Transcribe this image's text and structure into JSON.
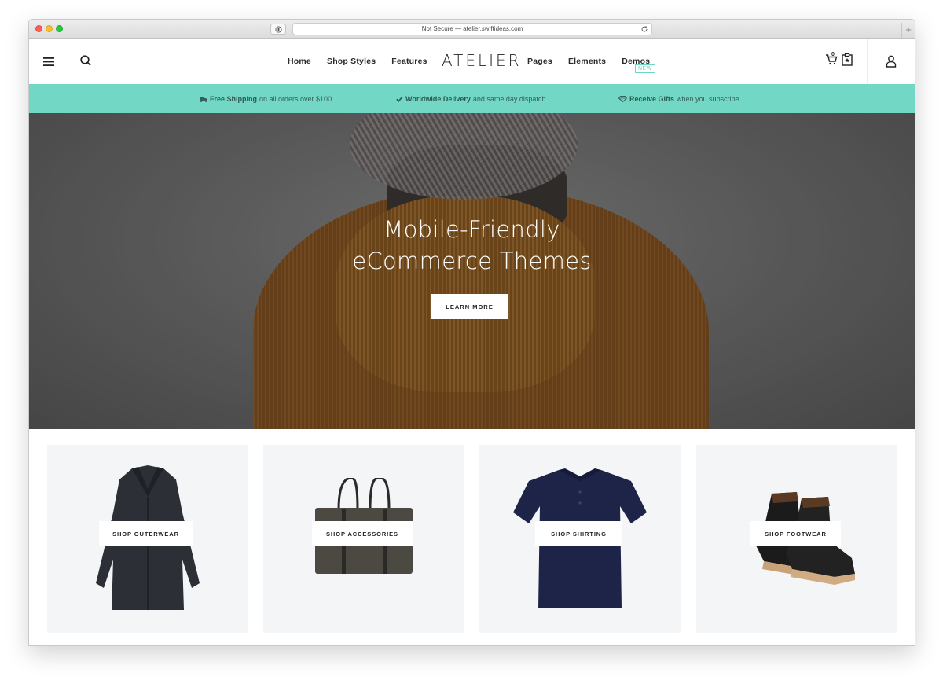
{
  "browser": {
    "address": "Not Secure — atelier.swiftideas.com",
    "new_tab": "+"
  },
  "header": {
    "logo": "ATELIER",
    "nav_left": [
      "Home",
      "Shop Styles",
      "Features"
    ],
    "nav_right": [
      "Pages",
      "Elements",
      "Demos"
    ],
    "new_badge": "NEW",
    "cart_count": "0"
  },
  "promo": [
    {
      "bold": "Free Shipping",
      "text": "on all orders over $100.",
      "icon": "truck-icon"
    },
    {
      "bold": "Worldwide Delivery",
      "text": "and same day dispatch.",
      "icon": "check-icon"
    },
    {
      "bold": "Receive Gifts",
      "text": "when you subscribe.",
      "icon": "diamond-icon"
    }
  ],
  "hero": {
    "title_line1": "Mobile-Friendly",
    "title_line2": "eCommerce Themes",
    "button": "LEARN MORE"
  },
  "categories": [
    {
      "label": "SHOP OUTERWEAR"
    },
    {
      "label": "SHOP ACCESSORIES"
    },
    {
      "label": "SHOP SHIRTING"
    },
    {
      "label": "SHOP FOOTWEAR"
    }
  ],
  "colors": {
    "promo_bg": "#72d7c4",
    "accent": "#70d6c3",
    "card_bg": "#f4f5f7"
  }
}
